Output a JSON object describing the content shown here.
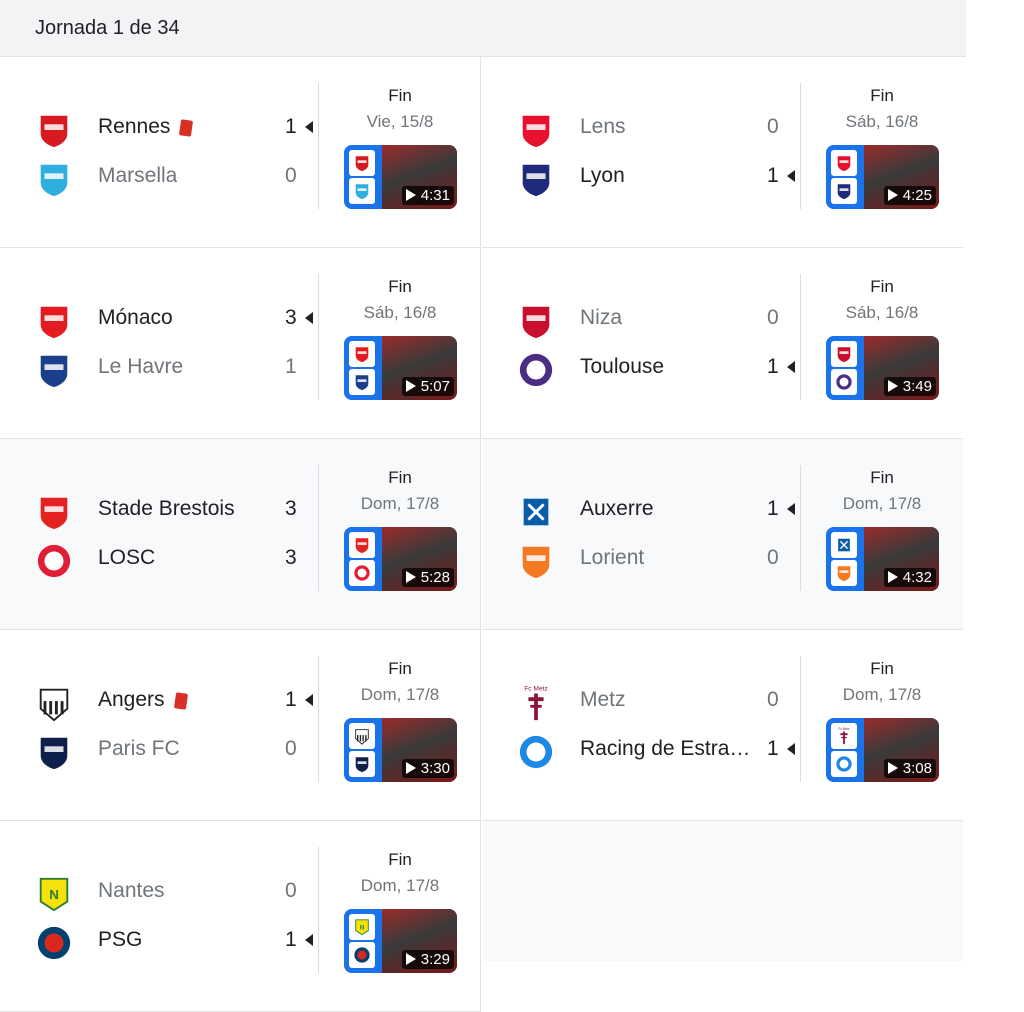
{
  "header": {
    "title": "Jornada 1 de 34"
  },
  "matches": [
    {
      "status": "Fin",
      "date": "Vie, 15/8",
      "duration": "4:31",
      "home": {
        "name": "Rennes",
        "score": "1",
        "winner": true,
        "red_card": true,
        "logo": "rennes-crest",
        "color": "#d71920"
      },
      "away": {
        "name": "Marsella",
        "score": "0",
        "winner": false,
        "red_card": false,
        "logo": "marseille-crest",
        "color": "#2faee0"
      }
    },
    {
      "status": "Fin",
      "date": "Sáb, 16/8",
      "duration": "4:25",
      "home": {
        "name": "Lens",
        "score": "0",
        "winner": false,
        "red_card": false,
        "logo": "lens-crest",
        "color": "#e8112d"
      },
      "away": {
        "name": "Lyon",
        "score": "1",
        "winner": true,
        "red_card": false,
        "logo": "lyon-crest",
        "color": "#1f2a7a"
      }
    },
    {
      "status": "Fin",
      "date": "Sáb, 16/8",
      "duration": "5:07",
      "home": {
        "name": "Mónaco",
        "score": "3",
        "winner": true,
        "red_card": false,
        "logo": "monaco-crest",
        "color": "#e51b22"
      },
      "away": {
        "name": "Le Havre",
        "score": "1",
        "winner": false,
        "red_card": false,
        "logo": "le-havre-crest",
        "color": "#1c3f8c"
      }
    },
    {
      "status": "Fin",
      "date": "Sáb, 16/8",
      "duration": "3:49",
      "home": {
        "name": "Niza",
        "score": "0",
        "winner": false,
        "red_card": false,
        "logo": "nice-crest",
        "color": "#c8102e"
      },
      "away": {
        "name": "Toulouse",
        "score": "1",
        "winner": true,
        "red_card": false,
        "logo": "toulouse-crest",
        "color": "#4b2d83"
      }
    },
    {
      "status": "Fin",
      "date": "Dom, 17/8",
      "duration": "5:28",
      "home": {
        "name": "Stade Brestois",
        "score": "3",
        "winner": false,
        "red_card": false,
        "logo": "brest-crest",
        "color": "#e32221"
      },
      "away": {
        "name": "LOSC",
        "score": "3",
        "winner": false,
        "red_card": false,
        "logo": "losc-crest",
        "color": "#e01e37"
      }
    },
    {
      "status": "Fin",
      "date": "Dom, 17/8",
      "duration": "4:32",
      "home": {
        "name": "Auxerre",
        "score": "1",
        "winner": true,
        "red_card": false,
        "logo": "auxerre-crest",
        "color": "#0a5ea8"
      },
      "away": {
        "name": "Lorient",
        "score": "0",
        "winner": false,
        "red_card": false,
        "logo": "lorient-crest",
        "color": "#f47920"
      }
    },
    {
      "status": "Fin",
      "date": "Dom, 17/8",
      "duration": "3:30",
      "home": {
        "name": "Angers",
        "score": "1",
        "winner": true,
        "red_card": true,
        "logo": "angers-crest",
        "color": "#222222"
      },
      "away": {
        "name": "Paris FC",
        "score": "0",
        "winner": false,
        "red_card": false,
        "logo": "paris-fc-crest",
        "color": "#0f1f4b"
      }
    },
    {
      "status": "Fin",
      "date": "Dom, 17/8",
      "duration": "3:08",
      "home": {
        "name": "Metz",
        "score": "0",
        "winner": false,
        "red_card": false,
        "logo": "metz-crest",
        "color": "#8a1538",
        "logo_text": "Fc Metz"
      },
      "away": {
        "name": "Racing de Estrasburgo",
        "score": "1",
        "winner": true,
        "red_card": false,
        "logo": "strasbourg-crest",
        "color": "#1e88e5"
      }
    },
    {
      "status": "Fin",
      "date": "Dom, 17/8",
      "duration": "3:29",
      "home": {
        "name": "Nantes",
        "score": "0",
        "winner": false,
        "red_card": false,
        "logo": "nantes-crest",
        "color": "#f5e10b"
      },
      "away": {
        "name": "PSG",
        "score": "1",
        "winner": true,
        "red_card": false,
        "logo": "psg-crest",
        "color": "#004170"
      }
    }
  ],
  "colors": {
    "header_bg": "#f1f3f4",
    "divider": "#e3e3e3",
    "video_frame": "#1a73e8",
    "red_card": "#d93025",
    "muted_text": "#70757a",
    "primary_text": "#202124"
  }
}
